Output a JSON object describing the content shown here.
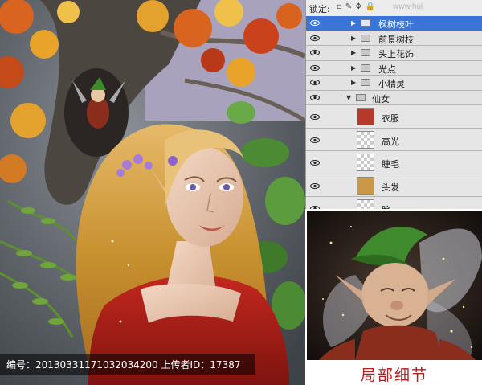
{
  "painting": {
    "caption": "编号：20130331171032034200 上传者ID：17387"
  },
  "layers_panel": {
    "lock_label": "锁定:",
    "watermark": "www.hui",
    "layers": [
      {
        "name": "枫树枝叶",
        "type": "group",
        "selected": true
      },
      {
        "name": "前景树枝",
        "type": "group",
        "selected": false
      },
      {
        "name": "头上花饰",
        "type": "group",
        "selected": false
      },
      {
        "name": "光点",
        "type": "group",
        "selected": false
      },
      {
        "name": "小精灵",
        "type": "group",
        "selected": false
      },
      {
        "name": "仙女",
        "type": "group",
        "expanded": true,
        "selected": false
      },
      {
        "name": "衣服",
        "type": "layer"
      },
      {
        "name": "高光",
        "type": "layer"
      },
      {
        "name": "睫毛",
        "type": "layer"
      },
      {
        "name": "头发",
        "type": "layer"
      },
      {
        "name": "脸",
        "type": "layer"
      }
    ]
  },
  "detail": {
    "caption": "局部细节"
  },
  "colors": {
    "selected_row": "#3a74d8",
    "caption_red": "#b3201d",
    "panel_bg": "#d4d4d4"
  }
}
